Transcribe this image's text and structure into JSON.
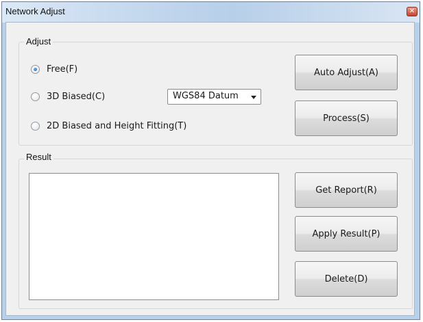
{
  "window": {
    "title": "Network Adjust",
    "close_glyph": "✕"
  },
  "adjust": {
    "label": "Adjust",
    "options": [
      {
        "label": "Free(F)",
        "checked": true
      },
      {
        "label": "3D Biased(C)",
        "checked": false
      },
      {
        "label": "2D Biased and Height Fitting(T)",
        "checked": false
      }
    ],
    "datum_select": {
      "value": "WGS84 Datum"
    },
    "buttons": {
      "auto_adjust": "Auto Adjust(A)",
      "process": "Process(S)"
    }
  },
  "result": {
    "label": "Result",
    "content": "",
    "buttons": {
      "get_report": "Get Report(R)",
      "apply_result": "Apply Result(P)",
      "delete": "Delete(D)"
    }
  }
}
